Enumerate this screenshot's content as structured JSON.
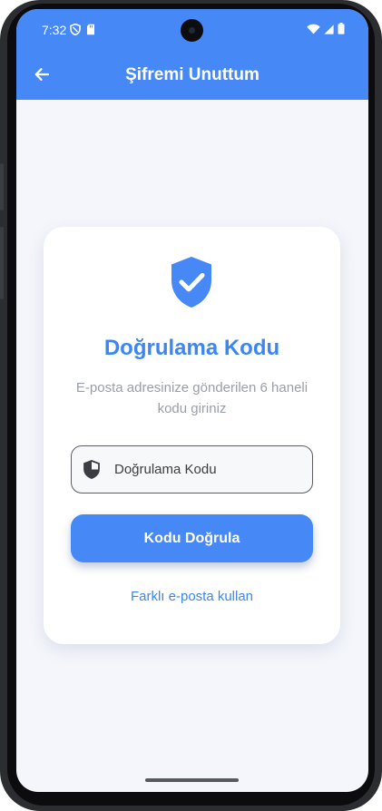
{
  "status_bar": {
    "time": "7:32",
    "left_icons": [
      "shield-status-icon",
      "sd-card-icon"
    ],
    "right_icons": [
      "wifi-icon",
      "signal-icon",
      "battery-icon"
    ]
  },
  "app_bar": {
    "title": "Şifremi Unuttum",
    "back_icon": "arrow-left-icon"
  },
  "card": {
    "icon": "shield-check-icon",
    "title": "Doğrulama Kodu",
    "description": "E-posta adresinize gönderilen 6 haneli kodu giriniz",
    "code_field": {
      "placeholder": "Doğrulama Kodu",
      "icon": "shield-half-icon"
    },
    "verify_button_label": "Kodu Doğrula",
    "alt_email_link": "Farklı e-posta kullan"
  },
  "colors": {
    "primary": "#4788f7",
    "title_blue": "#3d86f2",
    "background": "#f4f6fb",
    "muted_text": "#9a9ea6"
  }
}
